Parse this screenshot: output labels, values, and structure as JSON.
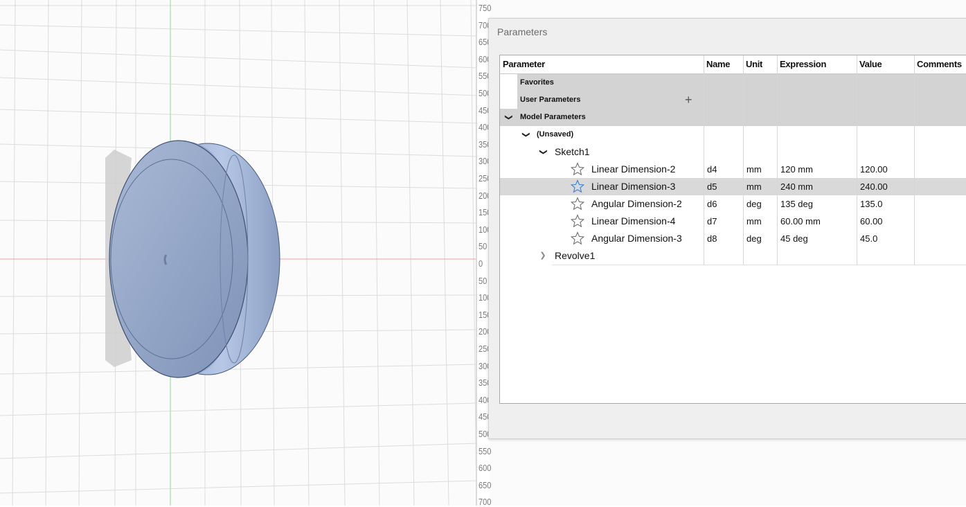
{
  "viewport": {
    "ruler_labels": [
      "750",
      "700",
      "650",
      "600",
      "550",
      "500",
      "450",
      "400",
      "350",
      "300",
      "250",
      "200",
      "150",
      "100",
      "50",
      "0",
      "50",
      "100",
      "150",
      "200",
      "250",
      "300",
      "350",
      "400",
      "450",
      "500",
      "550",
      "600",
      "650",
      "700"
    ]
  },
  "dialog": {
    "title": "Parameters",
    "columns": {
      "parameter": "Parameter",
      "name": "Name",
      "unit": "Unit",
      "expression": "Expression",
      "value": "Value",
      "comments": "Comments"
    },
    "groups": {
      "favorites": "Favorites",
      "user_parameters": "User Parameters",
      "model_parameters": "Model Parameters",
      "unsaved": "(Unsaved)",
      "sketch": "Sketch1",
      "revolve": "Revolve1"
    },
    "rows": [
      {
        "parameter": "Linear Dimension-2",
        "name": "d4",
        "unit": "mm",
        "expression": "120 mm",
        "value": "120.00",
        "comments": "",
        "selected": false
      },
      {
        "parameter": "Linear Dimension-3",
        "name": "d5",
        "unit": "mm",
        "expression": "240 mm",
        "value": "240.00",
        "comments": "",
        "selected": true
      },
      {
        "parameter": "Angular Dimension-2",
        "name": "d6",
        "unit": "deg",
        "expression": "135 deg",
        "value": "135.0",
        "comments": "",
        "selected": false
      },
      {
        "parameter": "Linear Dimension-4",
        "name": "d7",
        "unit": "mm",
        "expression": "60.00 mm",
        "value": "60.00",
        "comments": "",
        "selected": false
      },
      {
        "parameter": "Angular Dimension-3",
        "name": "d8",
        "unit": "deg",
        "expression": "45 deg",
        "value": "45.0",
        "comments": "",
        "selected": false
      }
    ],
    "icons": {
      "add_user_parameter": "plus-icon",
      "favorite": "star-outline-icon",
      "expanded": "chevron-down-icon",
      "collapsed": "chevron-right-icon"
    }
  }
}
